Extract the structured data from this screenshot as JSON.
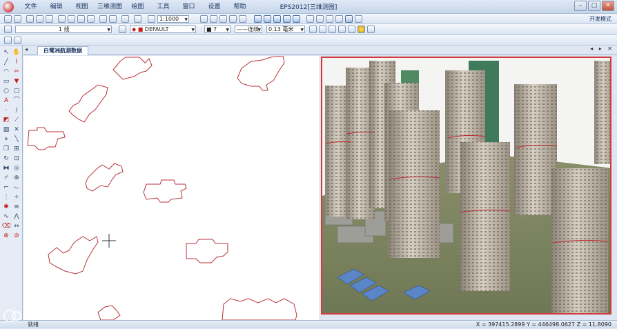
{
  "app": {
    "title": "EPS2012[三维测图]",
    "menu": [
      "文件",
      "编辑",
      "视图",
      "三维测图",
      "绘图",
      "工具",
      "窗口",
      "设置",
      "帮助"
    ]
  },
  "toolbar": {
    "scale_value": "1:1000",
    "layer_value": "1 线",
    "layer_name": "DEFAULT",
    "color_value": "7",
    "linetype_value": "——连续",
    "lineweight_value": "0.13 毫米",
    "user_label": "开发模式"
  },
  "document": {
    "tab_title": "白鹭洲航测数据"
  },
  "status": {
    "left_text": "就绪",
    "coords": "X = 397415.2899  Y = 446498.0627  Z = 11.8090"
  },
  "colors": {
    "accent": "#1f3864",
    "outline": "#b8323a",
    "frame": "#d43a3a"
  },
  "icons": {
    "tools": [
      "select",
      "pan",
      "zoom",
      "line",
      "arc",
      "circle",
      "rect",
      "polyline",
      "text",
      "point",
      "measure",
      "area",
      "layer",
      "style",
      "trim",
      "extend",
      "offset",
      "copy",
      "move",
      "rotate",
      "mirror",
      "scale",
      "delete",
      "undo"
    ]
  }
}
